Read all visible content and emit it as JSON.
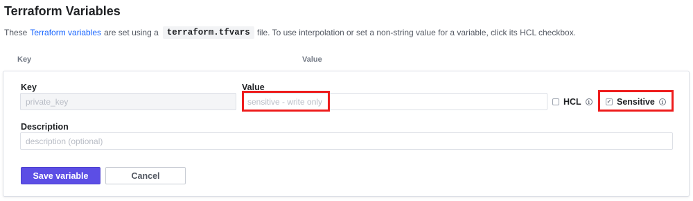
{
  "header": {
    "title": "Terraform Variables",
    "intro_prefix": "These",
    "intro_link": "Terraform variables",
    "intro_middle": "are set using a",
    "intro_code": "terraform.tfvars",
    "intro_suffix": "file. To use interpolation or set a non-string value for a variable, click its HCL checkbox."
  },
  "columns": {
    "key": "Key",
    "value": "Value"
  },
  "form": {
    "key_label": "Key",
    "key_value": "private_key",
    "value_label": "Value",
    "value_placeholder": "sensitive - write only",
    "hcl_label": "HCL",
    "hcl_checked": false,
    "sensitive_label": "Sensitive",
    "sensitive_checked": true,
    "description_label": "Description",
    "description_placeholder": "description (optional)",
    "save_label": "Save variable",
    "cancel_label": "Cancel"
  },
  "colors": {
    "link": "#1563ff",
    "primary_button": "#5c4ee5",
    "highlight": "#ee1c1c"
  },
  "icons": {
    "info": "info-icon",
    "checkmark": "check-icon"
  }
}
